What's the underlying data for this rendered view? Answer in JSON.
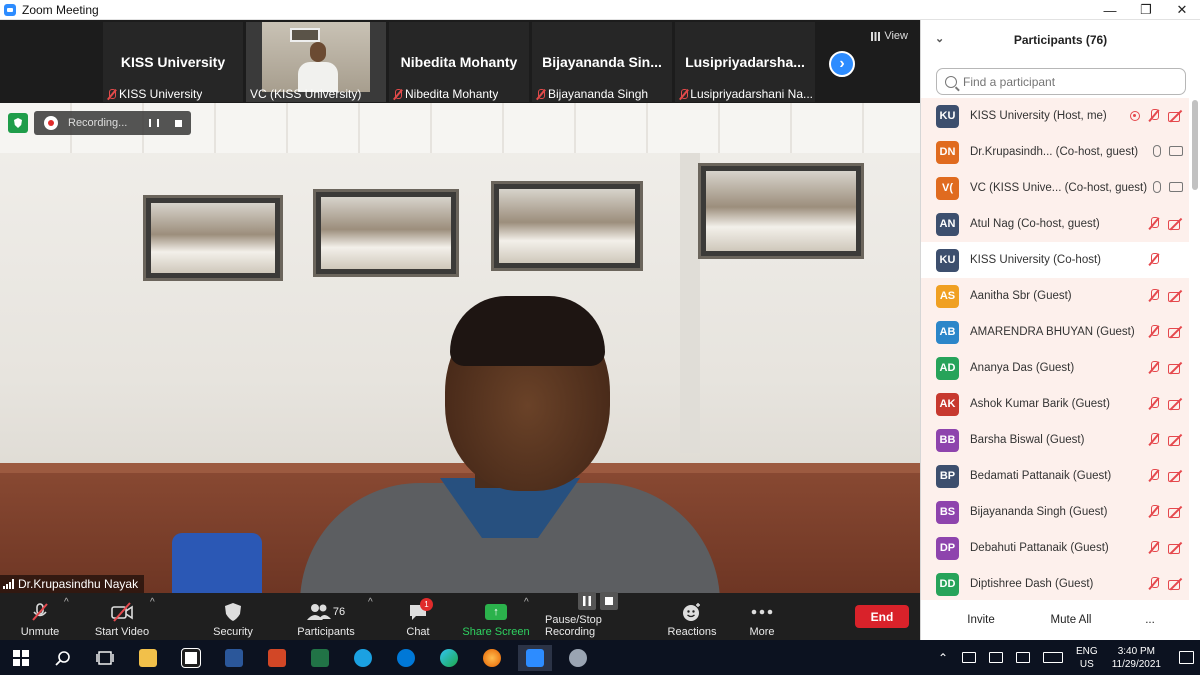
{
  "window": {
    "title": "Zoom Meeting",
    "minimize": "—",
    "restore": "❐",
    "close": "✕"
  },
  "strip": {
    "view_label": "View",
    "thumbs": [
      {
        "big": "KISS University",
        "label": "KISS University",
        "muted": true
      },
      {
        "big": "",
        "label": "VC (KISS University)",
        "muted": false,
        "video": true
      },
      {
        "big": "Nibedita Mohanty",
        "label": "Nibedita Mohanty",
        "muted": true
      },
      {
        "big": "Bijayananda  Sin...",
        "label": "Bijayananda Singh",
        "muted": true
      },
      {
        "big": "Lusipriyadarsha...",
        "label": "Lusipriyadarshani Na...",
        "muted": true
      }
    ]
  },
  "main": {
    "recording_text": "Recording...",
    "speaker_name": "Dr.Krupasindhu Nayak"
  },
  "toolbar": {
    "unmute": "Unmute",
    "start_video": "Start Video",
    "security": "Security",
    "participants": "Participants",
    "participants_count": "76",
    "chat": "Chat",
    "chat_badge": "1",
    "share_screen": "Share Screen",
    "pause_stop_recording": "Pause/Stop Recording",
    "reactions": "Reactions",
    "more": "More",
    "end": "End"
  },
  "participants_panel": {
    "title": "Participants (76)",
    "search_placeholder": "Find a participant",
    "invite": "Invite",
    "mute_all": "Mute All",
    "more": "...",
    "rows": [
      {
        "initials": "KU",
        "color": "#3d4f6e",
        "name": "KISS University (Host, me)",
        "mic": "off",
        "video": "off",
        "rec": true,
        "hl": true
      },
      {
        "initials": "DN",
        "color": "#e06b1f",
        "name": "Dr.Krupasindh...  (Co-host, guest)",
        "mic": "on",
        "video": "on",
        "hl": true
      },
      {
        "initials": "V(",
        "color": "#e06b1f",
        "name": "VC (KISS Unive...  (Co-host, guest)",
        "mic": "on",
        "video": "on",
        "hl": true
      },
      {
        "initials": "AN",
        "color": "#3d4f6e",
        "name": "Atul Nag (Co-host, guest)",
        "mic": "off",
        "video": "off",
        "hl": true
      },
      {
        "initials": "KU",
        "color": "#3d4f6e",
        "name": "KISS University (Co-host)",
        "mic": "off",
        "video": "none",
        "hl": false
      },
      {
        "initials": "AS",
        "color": "#f0a022",
        "name": "Aanitha Sbr (Guest)",
        "mic": "off",
        "video": "off",
        "hl": true
      },
      {
        "initials": "AB",
        "color": "#2c86c9",
        "name": "AMARENDRA BHUYAN (Guest)",
        "mic": "off",
        "video": "off",
        "hl": true
      },
      {
        "initials": "AD",
        "color": "#27a35a",
        "name": "Ananya Das (Guest)",
        "mic": "off",
        "video": "off",
        "hl": true
      },
      {
        "initials": "AK",
        "color": "#c7392f",
        "name": "Ashok Kumar Barik (Guest)",
        "mic": "off",
        "video": "off",
        "hl": true
      },
      {
        "initials": "BB",
        "color": "#8e44ad",
        "name": "Barsha Biswal (Guest)",
        "mic": "off",
        "video": "off",
        "hl": true
      },
      {
        "initials": "BP",
        "color": "#3d4f6e",
        "name": "Bedamati Pattanaik (Guest)",
        "mic": "off",
        "video": "off",
        "hl": true
      },
      {
        "initials": "BS",
        "color": "#8e44ad",
        "name": "Bijayananda Singh (Guest)",
        "mic": "off",
        "video": "off",
        "hl": true
      },
      {
        "initials": "DP",
        "color": "#8e44ad",
        "name": "Debahuti Pattanaik (Guest)",
        "mic": "off",
        "video": "off",
        "hl": true
      },
      {
        "initials": "DD",
        "color": "#27a35a",
        "name": "Diptishree Dash (Guest)",
        "mic": "off",
        "video": "off",
        "hl": true
      }
    ]
  },
  "taskbar": {
    "lang_1": "ENG",
    "lang_2": "US",
    "time": "3:40 PM",
    "date": "11/29/2021"
  }
}
